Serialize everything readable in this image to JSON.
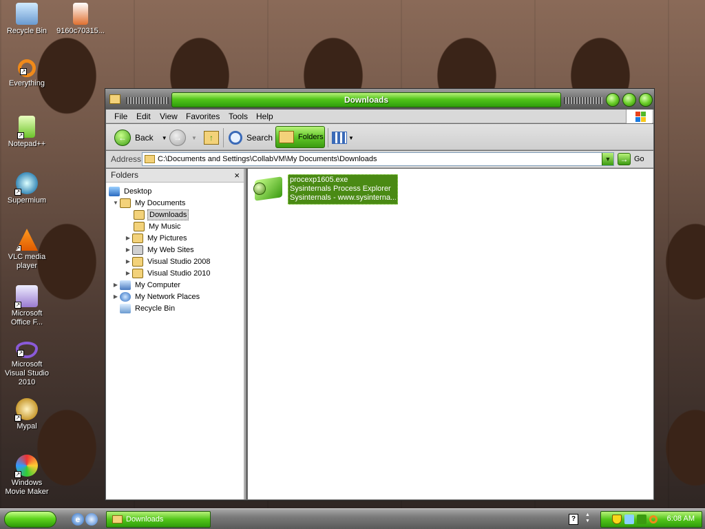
{
  "desktop": {
    "icons": [
      {
        "label": "Recycle Bin",
        "icon": "recycle-bin-icon"
      },
      {
        "label": "9160c70315...",
        "icon": "archive-file-icon"
      },
      {
        "label": "Everything",
        "icon": "everything-search-icon"
      },
      {
        "label": "Notepad++",
        "icon": "notepad-plus-plus-icon"
      },
      {
        "label": "Supermium",
        "icon": "supermium-browser-icon"
      },
      {
        "label": "VLC media player",
        "icon": "vlc-cone-icon"
      },
      {
        "label": "Microsoft Office F...",
        "icon": "office-icon"
      },
      {
        "label": "Microsoft Visual Studio 2010",
        "icon": "visual-studio-icon"
      },
      {
        "label": "Mypal",
        "icon": "mypal-browser-icon"
      },
      {
        "label": "Windows Movie Maker",
        "icon": "movie-maker-icon"
      }
    ]
  },
  "window": {
    "title": "Downloads",
    "menu": [
      "File",
      "Edit",
      "View",
      "Favorites",
      "Tools",
      "Help"
    ],
    "toolbar": {
      "back_label": "Back",
      "search_label": "Search",
      "folders_label": "Folders"
    },
    "address": {
      "label": "Address",
      "value": "C:\\Documents and Settings\\CollabVM\\My Documents\\Downloads",
      "go_label": "Go"
    },
    "folders_pane": {
      "title": "Folders",
      "close": "×",
      "tree": [
        {
          "label": "Desktop",
          "level": 0,
          "expander": ""
        },
        {
          "label": "My Documents",
          "level": 1,
          "expander": "▼"
        },
        {
          "label": "Downloads",
          "level": 2,
          "expander": "",
          "selected": true
        },
        {
          "label": "My Music",
          "level": 2,
          "expander": ""
        },
        {
          "label": "My Pictures",
          "level": 2,
          "expander": "▶"
        },
        {
          "label": "My Web Sites",
          "level": 2,
          "expander": "▶"
        },
        {
          "label": "Visual Studio 2008",
          "level": 2,
          "expander": "▶"
        },
        {
          "label": "Visual Studio 2010",
          "level": 2,
          "expander": "▶"
        },
        {
          "label": "My Computer",
          "level": 1,
          "expander": "▶"
        },
        {
          "label": "My Network Places",
          "level": 1,
          "expander": "▶"
        },
        {
          "label": "Recycle Bin",
          "level": 1,
          "expander": ""
        }
      ]
    },
    "files": [
      {
        "name": "procexp1605.exe",
        "description": "Sysinternals Process Explorer",
        "company": "Sysinternals - www.sysinterna..."
      }
    ]
  },
  "taskbar": {
    "task_label": "Downloads",
    "time": "6:08 AM",
    "help": "?"
  },
  "colors": {
    "accent_green": "#52c51a",
    "selection_green": "#4a8a14"
  }
}
